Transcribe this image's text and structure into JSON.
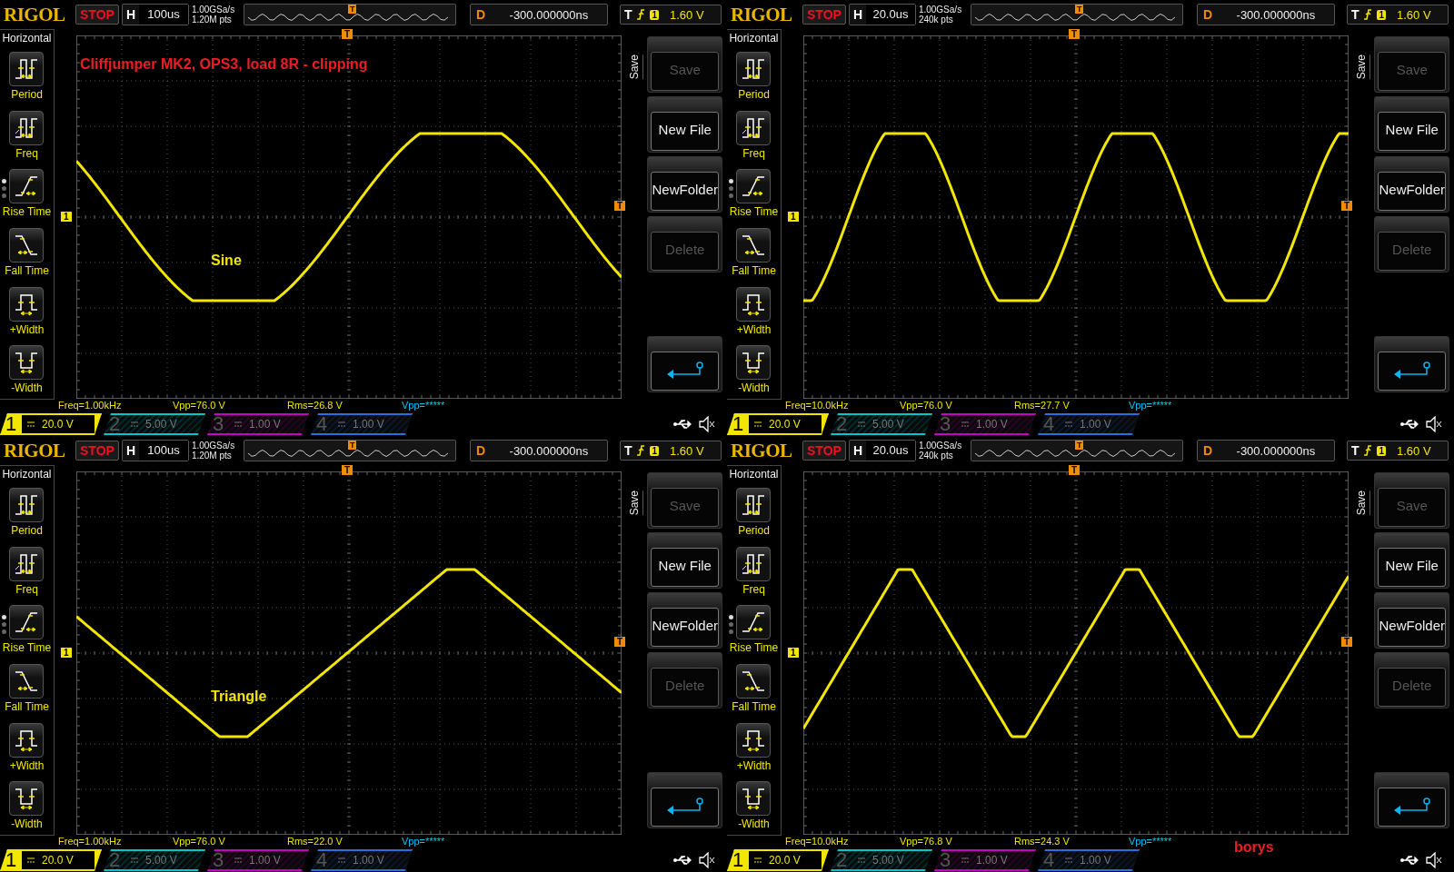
{
  "panels": [
    {
      "header": {
        "logo": "RIGOL",
        "run_state": "STOP",
        "h_label": "H",
        "timebase": "100us",
        "sample_rate": "1.00GSa/s",
        "memory_depth": "1.20M pts",
        "overview_marker": "T",
        "d_label": "D",
        "delay": "-300.000000ns",
        "t_label": "T",
        "trigger_source": "1",
        "trigger_level": "1.60 V"
      },
      "menu": {
        "title": "Horizontal",
        "items": [
          {
            "label": "Period",
            "kind": "period"
          },
          {
            "label": "Freq",
            "kind": "freq"
          },
          {
            "label": "Rise Time",
            "kind": "rise"
          },
          {
            "label": "Fall Time",
            "kind": "fall"
          },
          {
            "label": "+Width",
            "kind": "pwidth"
          },
          {
            "label": "-Width",
            "kind": "nwidth"
          }
        ],
        "pages": [
          {
            "selected": true
          },
          {
            "selected": false
          },
          {
            "selected": false
          }
        ]
      },
      "grid": {
        "trigger_marker": "T",
        "channel_marker": "1",
        "level_marker": "T"
      },
      "trace": {
        "kind": "clipped_sine_wide"
      },
      "annotations": [
        {
          "kind": "title",
          "text": "Cliffjumper MK2, OPS3, load 8R - clipping",
          "color": "#ee1c24"
        },
        {
          "kind": "label",
          "text": "Sine",
          "color": "#f2e600"
        }
      ],
      "softkeys": {
        "tab": "Save",
        "buttons": [
          {
            "kind": "text",
            "label": "Save",
            "disabled": true
          },
          {
            "kind": "text",
            "label": "New File",
            "disabled": false
          },
          {
            "kind": "text",
            "label": "NewFolder",
            "disabled": false
          },
          {
            "kind": "text",
            "label": "Delete",
            "disabled": true
          },
          {
            "kind": "return"
          }
        ]
      },
      "measurements": [
        {
          "text": "Freq=1.00kHz",
          "color": "#f2e600"
        },
        {
          "text": "Vpp=76.0 V",
          "color": "#f2e600"
        },
        {
          "text": "Rms=26.8 V",
          "color": "#f2e600"
        },
        {
          "text": "Vpp=*****",
          "color": "#00c8f0"
        }
      ],
      "channels": [
        {
          "number": "1",
          "scale": "20.0 V",
          "active": true,
          "color": "#f2e600"
        },
        {
          "number": "2",
          "scale": "5.00 V",
          "active": false,
          "color": "#00c8c8"
        },
        {
          "number": "3",
          "scale": "1.00 V",
          "active": false,
          "color": "#c800c8"
        },
        {
          "number": "4",
          "scale": "1.00 V",
          "active": false,
          "color": "#2a6ee0"
        }
      ]
    },
    {
      "header": {
        "logo": "RIGOL",
        "run_state": "STOP",
        "h_label": "H",
        "timebase": "20.0us",
        "sample_rate": "1.00GSa/s",
        "memory_depth": "240k pts",
        "overview_marker": "T",
        "d_label": "D",
        "delay": "-300.000000ns",
        "t_label": "T",
        "trigger_source": "1",
        "trigger_level": "1.60 V"
      },
      "menu": {
        "title": "Horizontal",
        "items": [
          {
            "label": "Period",
            "kind": "period"
          },
          {
            "label": "Freq",
            "kind": "freq"
          },
          {
            "label": "Rise Time",
            "kind": "rise"
          },
          {
            "label": "Fall Time",
            "kind": "fall"
          },
          {
            "label": "+Width",
            "kind": "pwidth"
          },
          {
            "label": "-Width",
            "kind": "nwidth"
          }
        ],
        "pages": [
          {
            "selected": true
          },
          {
            "selected": false
          },
          {
            "selected": false
          }
        ]
      },
      "grid": {
        "trigger_marker": "T",
        "channel_marker": "1",
        "level_marker": "T"
      },
      "trace": {
        "kind": "clipped_sine_narrow"
      },
      "softkeys": {
        "tab": "Save",
        "buttons": [
          {
            "kind": "text",
            "label": "Save",
            "disabled": true
          },
          {
            "kind": "text",
            "label": "New File",
            "disabled": false
          },
          {
            "kind": "text",
            "label": "NewFolder",
            "disabled": false
          },
          {
            "kind": "text",
            "label": "Delete",
            "disabled": true
          },
          {
            "kind": "return"
          }
        ]
      },
      "measurements": [
        {
          "text": "Freq=10.0kHz",
          "color": "#f2e600"
        },
        {
          "text": "Vpp=76.0 V",
          "color": "#f2e600"
        },
        {
          "text": "Rms=27.7 V",
          "color": "#f2e600"
        },
        {
          "text": "Vpp=*****",
          "color": "#00c8f0"
        }
      ],
      "channels": [
        {
          "number": "1",
          "scale": "20.0 V",
          "active": true,
          "color": "#f2e600"
        },
        {
          "number": "2",
          "scale": "5.00 V",
          "active": false,
          "color": "#00c8c8"
        },
        {
          "number": "3",
          "scale": "1.00 V",
          "active": false,
          "color": "#c800c8"
        },
        {
          "number": "4",
          "scale": "1.00 V",
          "active": false,
          "color": "#2a6ee0"
        }
      ]
    },
    {
      "header": {
        "logo": "RIGOL",
        "run_state": "STOP",
        "h_label": "H",
        "timebase": "100us",
        "sample_rate": "1.00GSa/s",
        "memory_depth": "1.20M pts",
        "overview_marker": "T",
        "d_label": "D",
        "delay": "-300.000000ns",
        "t_label": "T",
        "trigger_source": "1",
        "trigger_level": "1.60 V"
      },
      "menu": {
        "title": "Horizontal",
        "items": [
          {
            "label": "Period",
            "kind": "period"
          },
          {
            "label": "Freq",
            "kind": "freq"
          },
          {
            "label": "Rise Time",
            "kind": "rise"
          },
          {
            "label": "Fall Time",
            "kind": "fall"
          },
          {
            "label": "+Width",
            "kind": "pwidth"
          },
          {
            "label": "-Width",
            "kind": "nwidth"
          }
        ],
        "pages": [
          {
            "selected": true
          },
          {
            "selected": false
          },
          {
            "selected": false
          }
        ]
      },
      "grid": {
        "trigger_marker": "T",
        "channel_marker": "1",
        "level_marker": "T"
      },
      "trace": {
        "kind": "clipped_triangle_wide"
      },
      "annotations": [
        {
          "kind": "label",
          "text": "Triangle",
          "color": "#f2e600"
        }
      ],
      "softkeys": {
        "tab": "Save",
        "buttons": [
          {
            "kind": "text",
            "label": "Save",
            "disabled": true
          },
          {
            "kind": "text",
            "label": "New File",
            "disabled": false
          },
          {
            "kind": "text",
            "label": "NewFolder",
            "disabled": false
          },
          {
            "kind": "text",
            "label": "Delete",
            "disabled": true
          },
          {
            "kind": "return"
          }
        ]
      },
      "measurements": [
        {
          "text": "Freq=1.00kHz",
          "color": "#f2e600"
        },
        {
          "text": "Vpp=76.0 V",
          "color": "#f2e600"
        },
        {
          "text": "Rms=22.0 V",
          "color": "#f2e600"
        },
        {
          "text": "Vpp=*****",
          "color": "#00c8f0"
        }
      ],
      "channels": [
        {
          "number": "1",
          "scale": "20.0 V",
          "active": true,
          "color": "#f2e600"
        },
        {
          "number": "2",
          "scale": "5.00 V",
          "active": false,
          "color": "#00c8c8"
        },
        {
          "number": "3",
          "scale": "1.00 V",
          "active": false,
          "color": "#c800c8"
        },
        {
          "number": "4",
          "scale": "1.00 V",
          "active": false,
          "color": "#2a6ee0"
        }
      ]
    },
    {
      "header": {
        "logo": "RIGOL",
        "run_state": "STOP",
        "h_label": "H",
        "timebase": "20.0us",
        "sample_rate": "1.00GSa/s",
        "memory_depth": "240k pts",
        "overview_marker": "T",
        "d_label": "D",
        "delay": "-300.000000ns",
        "t_label": "T",
        "trigger_source": "1",
        "trigger_level": "1.60 V"
      },
      "menu": {
        "title": "Horizontal",
        "items": [
          {
            "label": "Period",
            "kind": "period"
          },
          {
            "label": "Freq",
            "kind": "freq"
          },
          {
            "label": "Rise Time",
            "kind": "rise"
          },
          {
            "label": "Fall Time",
            "kind": "fall"
          },
          {
            "label": "+Width",
            "kind": "pwidth"
          },
          {
            "label": "-Width",
            "kind": "nwidth"
          }
        ],
        "pages": [
          {
            "selected": true
          },
          {
            "selected": false
          },
          {
            "selected": false
          }
        ]
      },
      "grid": {
        "trigger_marker": "T",
        "channel_marker": "1",
        "level_marker": "T"
      },
      "trace": {
        "kind": "clipped_triangle_narrow"
      },
      "annotations": [
        {
          "kind": "signature",
          "text": "borys",
          "color": "#ee1c24"
        }
      ],
      "softkeys": {
        "tab": "Save",
        "buttons": [
          {
            "kind": "text",
            "label": "Save",
            "disabled": true
          },
          {
            "kind": "text",
            "label": "New File",
            "disabled": false
          },
          {
            "kind": "text",
            "label": "NewFolder",
            "disabled": false
          },
          {
            "kind": "text",
            "label": "Delete",
            "disabled": true
          },
          {
            "kind": "return"
          }
        ]
      },
      "measurements": [
        {
          "text": "Freq=10.0kHz",
          "color": "#f2e600"
        },
        {
          "text": "Vpp=76.8 V",
          "color": "#f2e600"
        },
        {
          "text": "Rms=24.3 V",
          "color": "#f2e600"
        },
        {
          "text": "Vpp=*****",
          "color": "#00c8f0"
        }
      ],
      "channels": [
        {
          "number": "1",
          "scale": "20.0 V",
          "active": true,
          "color": "#f2e600"
        },
        {
          "number": "2",
          "scale": "5.00 V",
          "active": false,
          "color": "#00c8c8"
        },
        {
          "number": "3",
          "scale": "1.00 V",
          "active": false,
          "color": "#c800c8"
        },
        {
          "number": "4",
          "scale": "1.00 V",
          "active": false,
          "color": "#2a6ee0"
        }
      ]
    }
  ]
}
